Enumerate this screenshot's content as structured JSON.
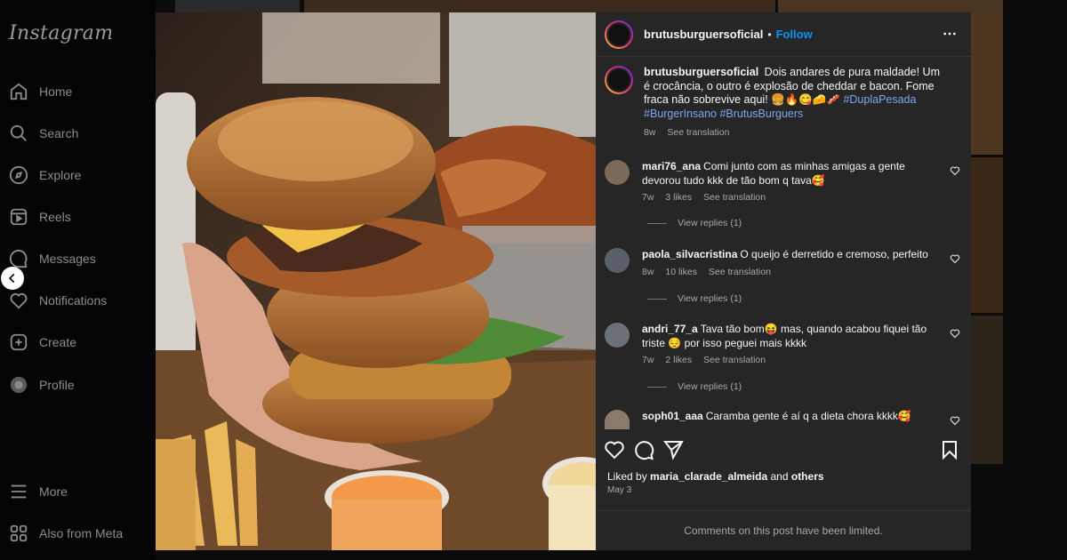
{
  "app": {
    "logo": "Instagram"
  },
  "sidebar": {
    "items": [
      {
        "label": "Home",
        "icon": "home-icon"
      },
      {
        "label": "Search",
        "icon": "search-icon"
      },
      {
        "label": "Explore",
        "icon": "explore-icon"
      },
      {
        "label": "Reels",
        "icon": "reels-icon"
      },
      {
        "label": "Messages",
        "icon": "messages-icon"
      },
      {
        "label": "Notifications",
        "icon": "heart-icon"
      },
      {
        "label": "Create",
        "icon": "create-icon"
      },
      {
        "label": "Profile",
        "icon": "profile-icon"
      }
    ],
    "bottom": [
      {
        "label": "More",
        "icon": "menu-icon"
      },
      {
        "label": "Also from Meta",
        "icon": "meta-icon"
      }
    ]
  },
  "post": {
    "author": "brutusburguersoficial",
    "dot": "•",
    "follow_label": "Follow",
    "avatar_text": "BRUTUS BURGUERS",
    "caption": {
      "text": "Dois andares de pura maldade! Um é crocância, o outro é explosão de cheddar e bacon. Fome fraca não sobrevive aqui! 🍔🔥😋🧀🥓",
      "tags": "#DuplaPesada",
      "tags2": "#BurgerInsano #BrutusBurguers",
      "age": "8w",
      "translate": "See translation"
    },
    "comments": [
      {
        "user": "mari76_ana",
        "text": "Comi junto com as minhas amigas a gente devorou tudo kkk de tão bom q tava🥰",
        "age": "7w",
        "likes": "3 likes",
        "translate": "See translation",
        "replies": "View replies (1)"
      },
      {
        "user": "paola_silvacristina",
        "text": "O queijo é derretido e cremoso, perfeito",
        "age": "8w",
        "likes": "10 likes",
        "translate": "See translation",
        "replies": "View replies (1)"
      },
      {
        "user": "andri_77_a",
        "text": "Tava tão bom😝 mas, quando acabou fiquei tão triste 😔 por isso peguei mais kkkk",
        "age": "7w",
        "likes": "2 likes",
        "translate": "See translation",
        "replies": "View replies (1)"
      },
      {
        "user": "soph01_aaa",
        "text": "Caramba gente é aí q a dieta chora kkkk🥰"
      }
    ],
    "liked_by_prefix": "Liked by",
    "liked_by_user": "maria_clarade_almeida",
    "liked_by_and": "and",
    "liked_by_others": "others",
    "date": "May 3",
    "limited_notice": "Comments on this post have been limited."
  },
  "colors": {
    "panel": "#262626",
    "link": "#0095f6",
    "hashtag": "#7ba6ee"
  }
}
